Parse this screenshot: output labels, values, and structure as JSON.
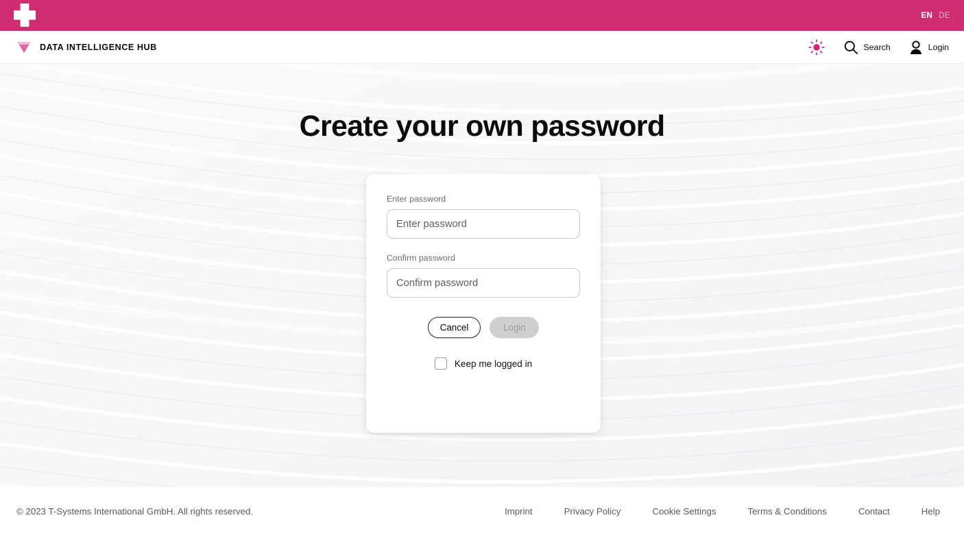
{
  "colors": {
    "magenta": "#ce2d72",
    "page_bg": "#ffffff",
    "hero_bg": "#fbfbfc",
    "card_bg": "#ffffff",
    "text_primary": "#0b0b0b",
    "text_muted": "#5a5a5a",
    "label_gray": "#6b6b6b",
    "input_border": "#c9c9c9",
    "disabled_button_bg": "#cfcfcf",
    "disabled_button_text": "#9b9b9b",
    "sun_icon": "#d1247a",
    "gem_icon": "#e57ab0"
  },
  "topbar": {
    "logo_icon": "t-mobile-t-logo",
    "languages": [
      {
        "code": "EN",
        "label": "EN",
        "active": true
      },
      {
        "code": "DE",
        "label": "DE",
        "active": false
      }
    ]
  },
  "navbar": {
    "brand_icon": "diamond-gem-icon",
    "brand_name": "DATA INTELLIGENCE HUB",
    "actions": [
      {
        "icon": "sun-icon",
        "label": "",
        "name": "theme-toggle"
      },
      {
        "icon": "search-icon",
        "label": "Search",
        "name": "search"
      },
      {
        "icon": "user-icon",
        "label": "Login",
        "name": "login"
      }
    ]
  },
  "hero": {
    "title": "Create your own password"
  },
  "form": {
    "fields": [
      {
        "name": "enter-password",
        "label": "Enter password",
        "placeholder": "Enter password",
        "value": "",
        "type": "password"
      },
      {
        "name": "confirm-password",
        "label": "Confirm password",
        "placeholder": "Confirm password",
        "value": "",
        "type": "password"
      }
    ],
    "buttons": [
      {
        "name": "cancel",
        "label": "Cancel",
        "style": "outline",
        "disabled": false
      },
      {
        "name": "login",
        "label": "Login",
        "style": "filled-disabled",
        "disabled": true
      }
    ],
    "checkbox": {
      "name": "keep-me-logged-in",
      "label": "Keep me logged in",
      "checked": false
    },
    "stray_artifact": "`"
  },
  "footer": {
    "copyright": "© 2023 T-Systems International GmbH. All rights reserved.",
    "links": [
      {
        "label": "Imprint"
      },
      {
        "label": "Privacy Policy"
      },
      {
        "label": "Cookie Settings"
      },
      {
        "label": "Terms & Conditions"
      },
      {
        "label": "Contact"
      },
      {
        "label": "Help"
      }
    ]
  }
}
